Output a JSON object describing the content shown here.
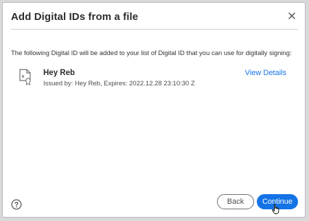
{
  "dialog": {
    "title": "Add Digital IDs from a file",
    "close_icon": "close-icon",
    "description": "The following Digital ID will be added to your list of Digital ID that you can use for digitally signing:"
  },
  "digital_id": {
    "icon": "certificate-icon",
    "name": "Hey Reb",
    "issued": "Issued by: Hey Reb, Expires: 2022.12.28 23:10:30 Z",
    "view_details_label": "View Details"
  },
  "footer": {
    "help_icon": "help-icon",
    "back_label": "Back",
    "continue_label": "Continue"
  },
  "colors": {
    "accent": "#1473e6"
  }
}
